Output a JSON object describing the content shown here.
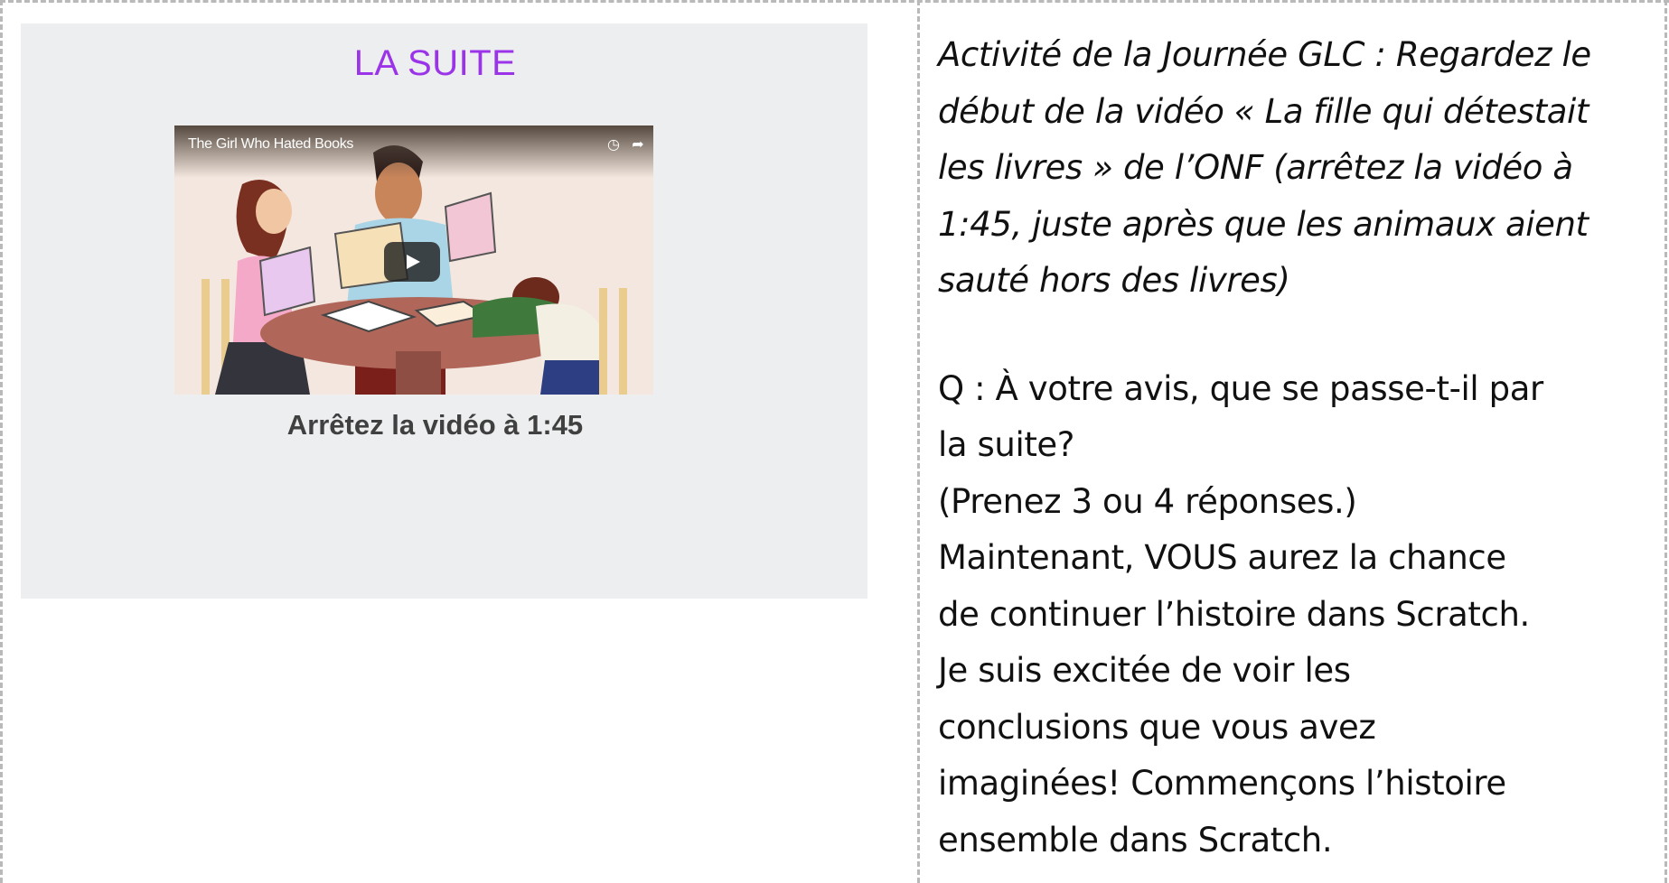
{
  "slide": {
    "title": "LA SUITE",
    "video": {
      "title": "The Girl Who Hated Books",
      "icons": [
        "clock-icon",
        "share-icon",
        "play-icon"
      ]
    },
    "caption": "Arrêtez la vidéo à 1:45"
  },
  "notes": {
    "activity_lines": [
      "Activité de la Journée GLC : Regardez le",
      "début de la vidéo « La fille qui détestait",
      "les livres » de l’ONF (arrêtez la vidéo à",
      "1:45, juste après que les animaux aient",
      "sauté hors des livres)"
    ],
    "body_lines": [
      "Q : À votre avis, que se passe-t-il par",
      "la suite?",
      "(Prenez 3 ou 4 réponses.)",
      "Maintenant, VOUS aurez la chance",
      "de continuer l’histoire dans Scratch.",
      "Je suis excitée de voir les",
      "conclusions que vous avez",
      "imaginées! Commençons l’histoire",
      "ensemble dans Scratch."
    ]
  },
  "colors": {
    "title": "#9b34e8",
    "slide_background": "#eceeef",
    "border": "#b9b9b9"
  }
}
